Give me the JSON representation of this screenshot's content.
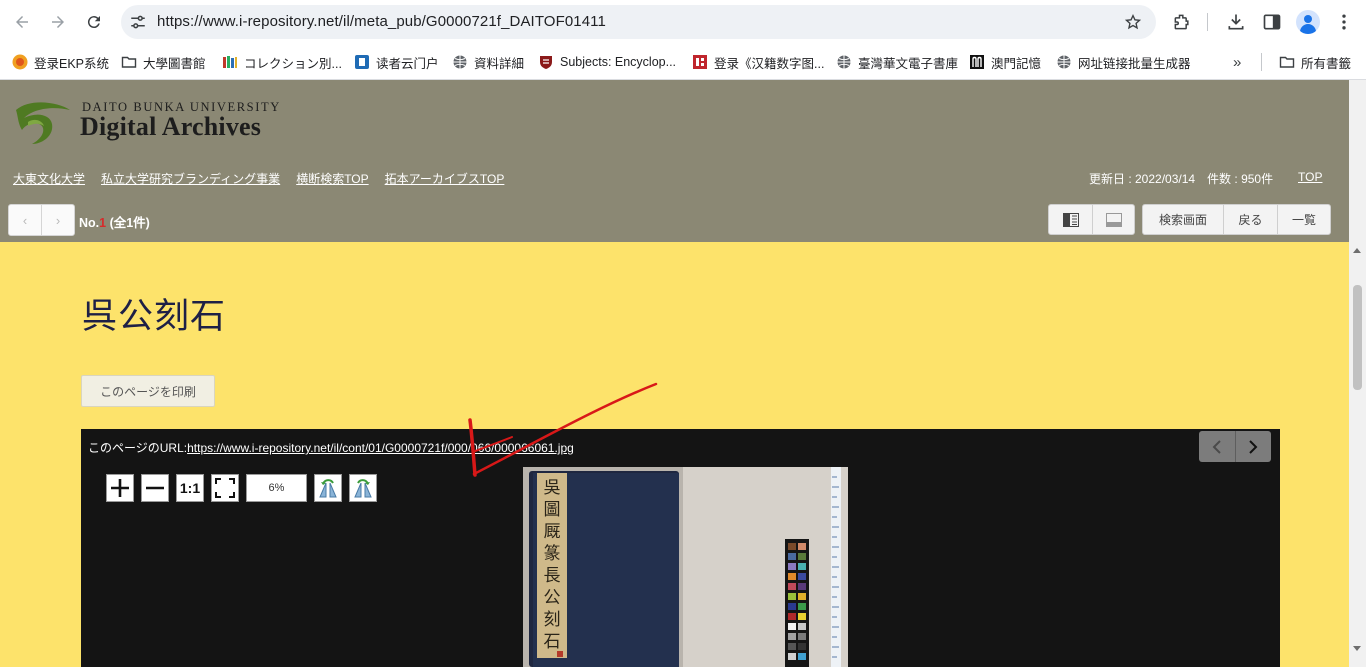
{
  "browser": {
    "url": "https://www.i-repository.net/il/meta_pub/G0000721f_DAITOF01411",
    "bookmarks": [
      {
        "label": "登录EKP系统",
        "icon": "ekp-icon"
      },
      {
        "label": "大學圖書館",
        "icon": "folder-icon"
      },
      {
        "label": "コレクション別...",
        "icon": "books-icon"
      },
      {
        "label": "读者云门户",
        "icon": "reader-icon"
      },
      {
        "label": "資料詳細",
        "icon": "globe-icon"
      },
      {
        "label": "Subjects: Encyclop...",
        "icon": "shield-icon"
      },
      {
        "label": "登录《汉籍数字图...",
        "icon": "seal-icon"
      },
      {
        "label": "臺灣華文電子書庫",
        "icon": "globe-icon"
      },
      {
        "label": "澳門記憶",
        "icon": "memory-icon"
      },
      {
        "label": "网址链接批量生成器",
        "icon": "globe-icon"
      }
    ],
    "all_bookmarks": "所有書籤",
    "more": "»"
  },
  "site": {
    "university": "DAITO BUNKA UNIVERSITY",
    "name": "Digital Archives",
    "links": [
      "大東文化大学",
      "私立大学研究ブランディング事業",
      "横断検索TOP",
      "拓本アーカイブスTOP"
    ],
    "updated": "更新日 : 2022/03/14　件数 : 950件",
    "top": "TOP"
  },
  "record": {
    "prefix": "No.",
    "number": "1",
    "total": " (全1件)",
    "actions": [
      "検索画面",
      "戻る",
      "一覧"
    ]
  },
  "content": {
    "title": "呉公刻石",
    "print_label": "このページを印刷",
    "url_label": "このページのURL:",
    "image_url": "https://www.i-repository.net/il/cont/01/G0000721f/000/066/000066061.jpg",
    "zoom": "6%",
    "one_to_one": "1:1"
  },
  "colors": {
    "header_bg": "#8b8874",
    "content_bg": "#fde36b",
    "viewer_bg": "#141414",
    "logo_green": "#5b7d2b",
    "annotation": "#d81818"
  }
}
